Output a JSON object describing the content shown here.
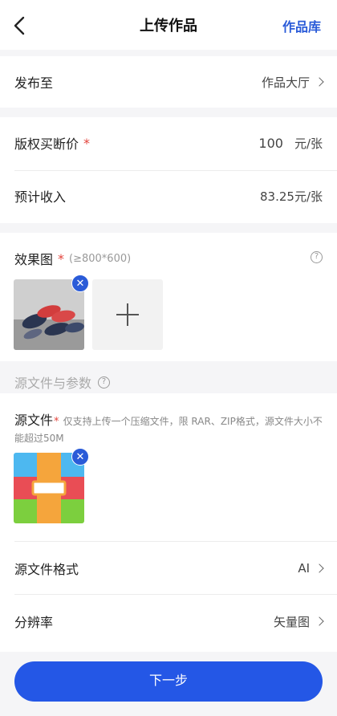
{
  "header": {
    "title": "上传作品",
    "library_link": "作品库"
  },
  "publish": {
    "label": "发布至",
    "value": "作品大厅"
  },
  "price": {
    "label": "版权买断价",
    "required_mark": "*",
    "input_value": "100",
    "unit": "元/张"
  },
  "income": {
    "label": "预计收入",
    "value": "83.25元/张"
  },
  "effect_image": {
    "label": "效果图",
    "required_mark": "*",
    "size_hint": "(≥800*600)",
    "help_icon": "?"
  },
  "section": {
    "title": "源文件与参数",
    "help_icon": "?"
  },
  "source_file": {
    "label": "源文件",
    "required_mark": "*",
    "hint": "仅支持上传一个压缩文件，限 RAR、ZIP格式，源文件大小不能超过50M"
  },
  "format": {
    "label": "源文件格式",
    "value": "AI"
  },
  "resolution": {
    "label": "分辨率",
    "value": "矢量图"
  },
  "next_button": {
    "label": "下一步"
  },
  "colors": {
    "accent": "#2457e6",
    "price_red": "#e3443c",
    "text": "#222222"
  },
  "icons": [
    "back-chevron-icon",
    "chevron-right-icon",
    "help-circle-icon",
    "remove-x-icon",
    "plus-icon",
    "archive-file-icon"
  ]
}
